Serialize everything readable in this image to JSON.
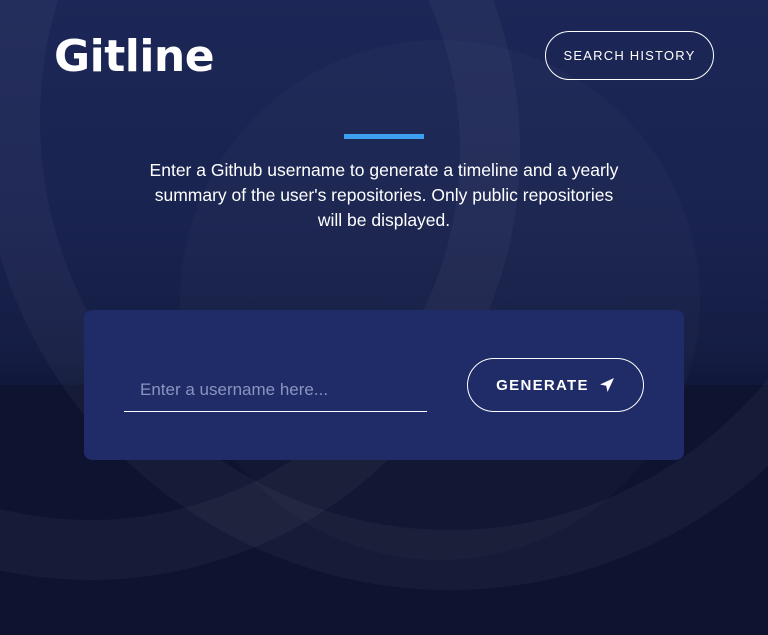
{
  "app": {
    "logo_text": "Gitline"
  },
  "header": {
    "search_history_label": "SEARCH HISTORY"
  },
  "intro": {
    "text": "Enter a Github username to generate a timeline and a yearly summary of the user's repositories. Only public repositories will be displayed."
  },
  "form": {
    "username_placeholder": "Enter a username here...",
    "username_value": "",
    "generate_label": "GENERATE",
    "generate_icon": "send-icon"
  },
  "colors": {
    "accent": "#3d9ff0",
    "card": "#1f2c68",
    "background_top": "#1c2757",
    "background_bottom": "#0e1430"
  }
}
